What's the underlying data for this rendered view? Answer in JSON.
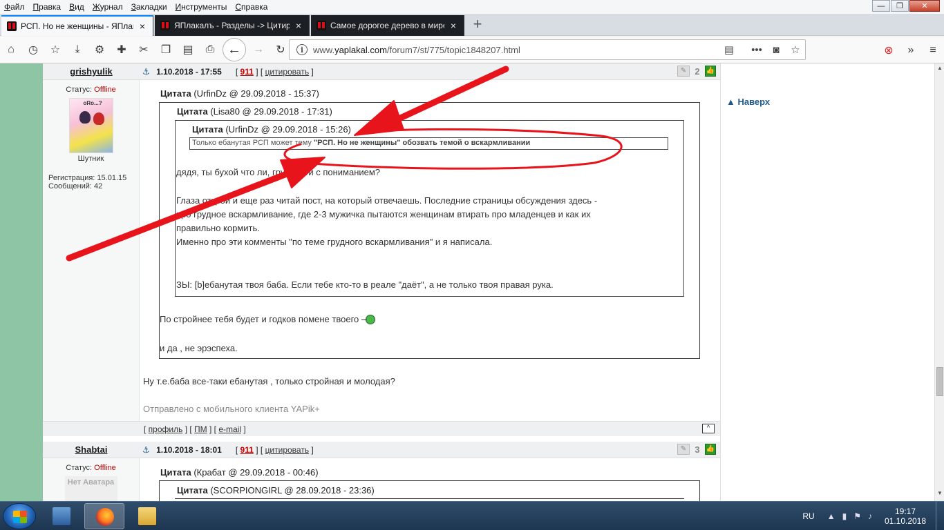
{
  "menu": [
    "Файл",
    "Правка",
    "Вид",
    "Журнал",
    "Закладки",
    "Инструменты",
    "Справка"
  ],
  "window_controls": {
    "min": "—",
    "max": "❐",
    "close": "✕"
  },
  "tabs": [
    {
      "label": "РСП. Но не женщины - ЯПлакалъ",
      "active": true,
      "close": "×"
    },
    {
      "label": "ЯПлакалъ - Разделы -> Цитир",
      "active": false,
      "close": "×"
    },
    {
      "label": "Самое дорогое дерево в мире",
      "active": false,
      "close": "×"
    }
  ],
  "newtab": "+",
  "address": {
    "prefix": "www.",
    "domain": "yaplakal.com",
    "path": "/forum7/st/775/topic1848207.html"
  },
  "right_col": {
    "top_link": "Наверх"
  },
  "post1": {
    "author": "grishyulik",
    "anchor": "⚓",
    "date": "1.10.2018 - 17:55",
    "rep": "911",
    "quote_link": "цитировать",
    "number": "2",
    "status_label": "Статус:",
    "status": "Offline",
    "avatar_caption": "oRo...?",
    "rank": "Шутник",
    "reg_label": "Регистрация:",
    "reg": "15.01.15",
    "msgs_label": "Сообщений:",
    "msgs": "42",
    "quote1_head": "Цитата",
    "quote1_src": "(UrfinDz @ 29.09.2018 - 15:37)",
    "quote2_head": "Цитата",
    "quote2_src": "(Lisa80 @ 29.09.2018 - 17:31)",
    "quote3_head": "Цитата",
    "quote3_src": "(UrfinDz @ 29.09.2018 - 15:26)",
    "quote3_text_a": "Только ебанутая РСП может тему ",
    "quote3_text_b": "\"РСП. Но не женщины\" обозвать темой о вскармливании",
    "q2_line1": "дядя, ты бухой что ли, грудности с пониманием?",
    "q2_line2": "Глаза открой и еще раз читай пост, на который отвечаешь. Последние страницы обсуждения здесь -",
    "q2_line3": "про грудное вскармливание, где 2-3 мужичка пытаются женщинам втирать про младенцев и как их",
    "q2_line4": "правильно кормить.",
    "q2_line5": "Именно про эти комменты \"по теме грудного вскармливания\" и я написала.",
    "q2_line6": "ЗЫ: [b]ебанутая твоя баба. Если тебе кто-то в реале \"даёт\", а не только твоя правая рука.",
    "q1_line1": "По стройнее тебя будет и годков помене твоего",
    "q1_line2": "и да , не эрэспеха.",
    "reply": "Ну т.е.баба все-таки ебанутая , только стройная и молодая?",
    "signature": "Отправлено с мобильного клиента YAPik+",
    "foot_profile": "профиль",
    "foot_pm": "ПМ",
    "foot_email": "e-mail",
    "foot_top": "^"
  },
  "post2": {
    "author": "Shabtai",
    "anchor": "⚓",
    "date": "1.10.2018 - 18:01",
    "rep": "911",
    "quote_link": "цитировать",
    "number": "3",
    "status_label": "Статус:",
    "status": "Offline",
    "no_avatar": "Нет Аватара",
    "quote1_head": "Цитата",
    "quote1_src": "(Крабат @ 29.09.2018 - 00:46)",
    "quote2_head": "Цитата",
    "quote2_src": "(SCORPIONGIRL @ 28.09.2018 - 23:36)"
  },
  "taskbar": {
    "lang": "RU",
    "time": "19:17",
    "date": "01.10.2018"
  },
  "colors": {
    "accent": "#0a84ff",
    "annotation": "#e8141b",
    "offline": "#bb0000",
    "forum_bg": "#8ec5a5"
  }
}
